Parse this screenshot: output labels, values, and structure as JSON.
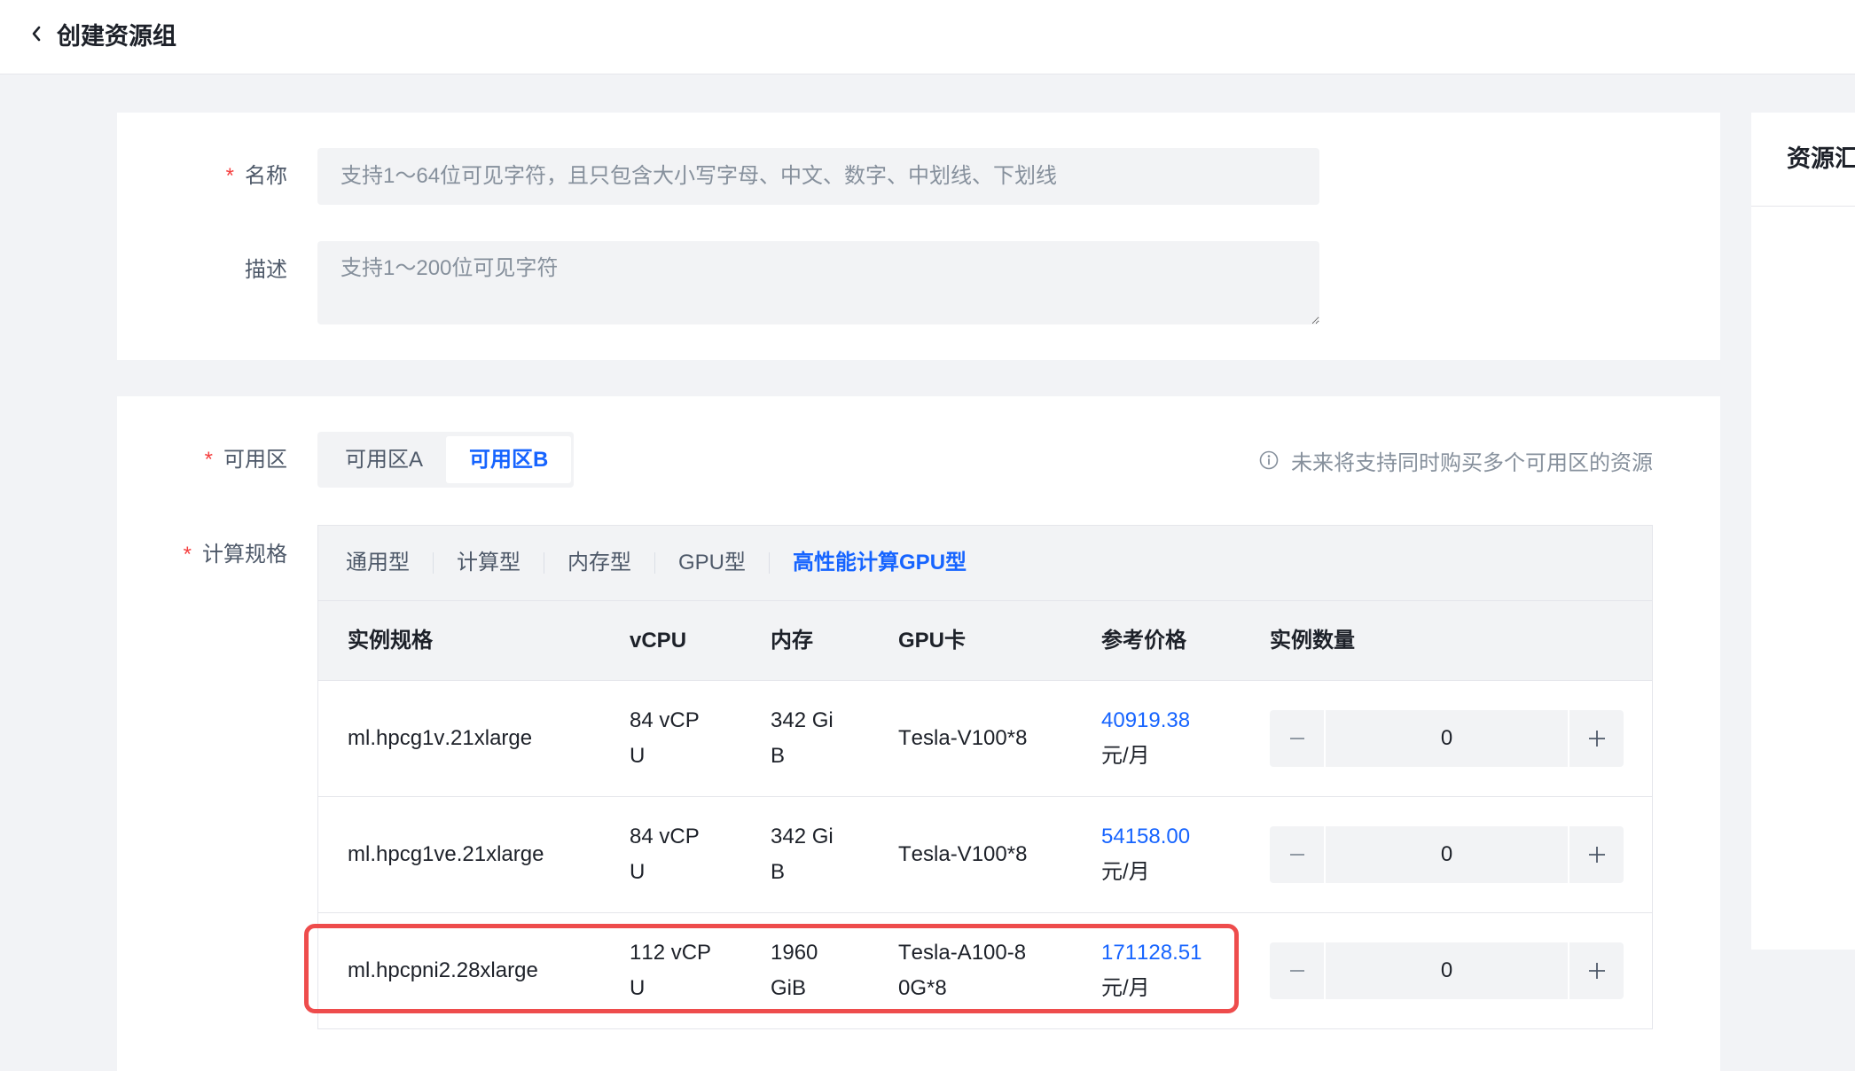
{
  "header": {
    "title": "创建资源组",
    "back_icon": "chevron-left-icon"
  },
  "basic": {
    "name": {
      "required_mark": "*",
      "label": "名称",
      "placeholder": "支持1～64位可见字符，且只包含大小写字母、中文、数字、中划线、下划线"
    },
    "description": {
      "label": "描述",
      "placeholder": "支持1～200位可见字符"
    }
  },
  "zone": {
    "required_mark": "*",
    "label": "可用区",
    "options": [
      {
        "label": "可用区A",
        "selected": false
      },
      {
        "label": "可用区B",
        "selected": true
      }
    ],
    "hint_icon": "info-icon",
    "hint": "未来将支持同时购买多个可用区的资源"
  },
  "spec": {
    "required_mark": "*",
    "label": "计算规格",
    "tabs": [
      {
        "label": "通用型",
        "selected": false
      },
      {
        "label": "计算型",
        "selected": false
      },
      {
        "label": "内存型",
        "selected": false
      },
      {
        "label": "GPU型",
        "selected": false
      },
      {
        "label": "高性能计算GPU型",
        "selected": true
      }
    ],
    "columns": [
      "实例规格",
      "vCPU",
      "内存",
      "GPU卡",
      "参考价格",
      "实例数量"
    ],
    "rows": [
      {
        "name": "ml.hpcg1v.21xlarge",
        "vcpu": "84 vCPU",
        "memory": "342 GiB",
        "gpu": "Tesla-V100*8",
        "price": "40919.38",
        "price_unit": "元/月",
        "quantity": "0"
      },
      {
        "name": "ml.hpcg1ve.21xlarge",
        "vcpu": "84 vCPU",
        "memory": "342 GiB",
        "gpu": "Tesla-V100*8",
        "price": "54158.00",
        "price_unit": "元/月",
        "quantity": "0"
      },
      {
        "name": "ml.hpcpni2.28xlarge",
        "vcpu": "112 vCPU",
        "memory": "1960 GiB",
        "gpu": "Tesla-A100-80G*8",
        "price": "171128.51",
        "price_unit": "元/月",
        "quantity": "0"
      }
    ],
    "stepper_icons": {
      "decrement": "minus-icon",
      "increment": "plus-icon"
    }
  },
  "summary_panel": {
    "title": "资源汇"
  },
  "colors": {
    "accent": "#1664ff",
    "required_mark": "#f53f3f",
    "highlight_box": "#ee4c4c"
  }
}
